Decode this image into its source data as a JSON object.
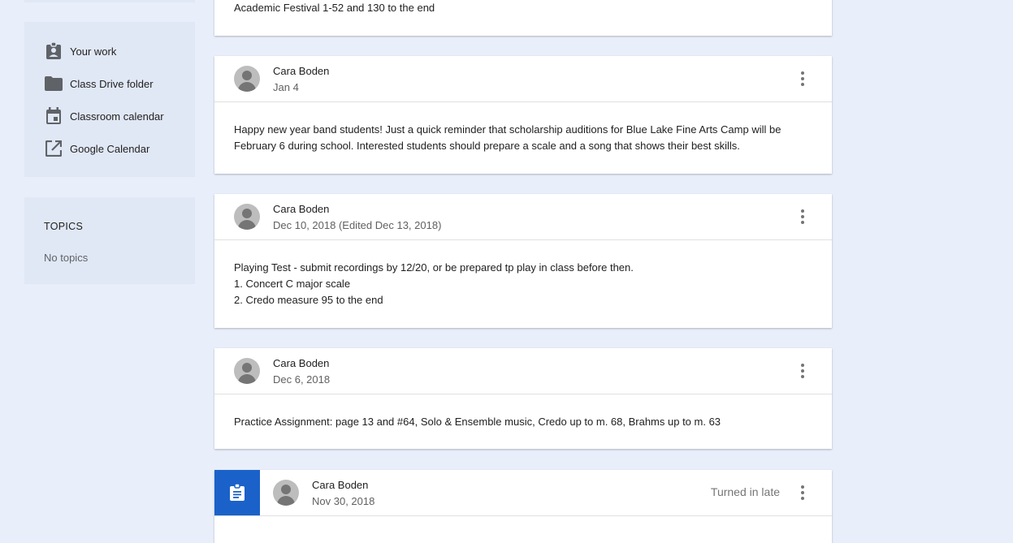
{
  "sidebar": {
    "links": [
      {
        "label": "Your work",
        "icon": "assignment-ind-icon"
      },
      {
        "label": "Class Drive folder",
        "icon": "folder-icon"
      },
      {
        "label": "Classroom calendar",
        "icon": "calendar-icon"
      },
      {
        "label": "Google Calendar",
        "icon": "open-in-new-icon"
      }
    ],
    "topics": {
      "title": "TOPICS",
      "empty": "No topics"
    }
  },
  "stream": {
    "partial_post": {
      "body": "Academic Festival 1-52 and 130 to the end"
    },
    "posts": [
      {
        "author": "Cara Boden",
        "date": "Jan 4",
        "lines": [
          "Happy new year band students! Just a quick reminder that scholarship auditions for Blue Lake Fine Arts Camp will be",
          "February 6 during school. Interested students should prepare a scale and a song that shows their best skills."
        ]
      },
      {
        "author": "Cara Boden",
        "date": "Dec 10, 2018 (Edited Dec 13, 2018)",
        "lines": [
          "Playing Test - submit recordings by 12/20, or be prepared tp play in class before then.",
          "1. Concert C major scale",
          "2. Credo measure 95 to the end"
        ]
      },
      {
        "author": "Cara Boden",
        "date": "Dec 6, 2018",
        "lines": [
          "Practice Assignment: page 13 and #64, Solo & Ensemble music, Credo up to m. 68, Brahms up to m. 63"
        ]
      }
    ],
    "assignment": {
      "author": "Cara Boden",
      "date": "Nov 30, 2018",
      "status": "Turned in late",
      "icon": "assignment-icon"
    }
  },
  "colors": {
    "page_bg": "#e8eefa",
    "sidebar_bg": "#e1e8f5",
    "assignment_accent": "#1a62c9",
    "icon_gray": "#5f6368"
  }
}
